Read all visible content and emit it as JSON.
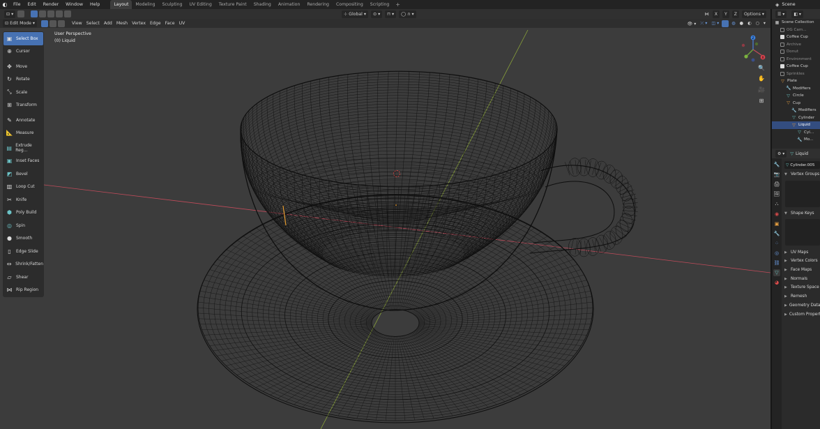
{
  "topbar": {
    "menus": [
      "File",
      "Edit",
      "Render",
      "Window",
      "Help"
    ],
    "workspaces": [
      "Layout",
      "Modeling",
      "Sculpting",
      "UV Editing",
      "Texture Paint",
      "Shading",
      "Animation",
      "Rendering",
      "Compositing",
      "Scripting"
    ],
    "active_workspace": "Layout",
    "add_tab": "+",
    "scene": "Scene"
  },
  "viewport": {
    "mode": "Edit Mode",
    "header_menus": [
      "View",
      "Select",
      "Add",
      "Mesh",
      "Vertex",
      "Edge",
      "Face",
      "UV"
    ],
    "orientation": "Global",
    "axes": [
      "X",
      "Y",
      "Z"
    ],
    "options": "Options",
    "overlay_line1": "User Perspective",
    "overlay_line2": "(0) Liquid",
    "gizmo": {
      "x": "X",
      "y": "Y",
      "z": "Z"
    }
  },
  "toolbar": {
    "tools": [
      {
        "label": "Select Box",
        "icon": "▣",
        "active": true
      },
      {
        "label": "Cursor",
        "icon": "⊕"
      },
      {
        "sep": true
      },
      {
        "label": "Move",
        "icon": "✥"
      },
      {
        "label": "Rotate",
        "icon": "↻"
      },
      {
        "label": "Scale",
        "icon": "⤡"
      },
      {
        "label": "Transform",
        "icon": "⊞"
      },
      {
        "sep": true
      },
      {
        "label": "Annotate",
        "icon": "✎"
      },
      {
        "label": "Measure",
        "icon": "📐"
      },
      {
        "sep": true
      },
      {
        "label": "Extrude Reg...",
        "icon": "▤",
        "teal": true
      },
      {
        "label": "Inset Faces",
        "icon": "▣",
        "teal": true
      },
      {
        "label": "Bevel",
        "icon": "◩",
        "teal": true
      },
      {
        "label": "Loop Cut",
        "icon": "▥"
      },
      {
        "label": "Knife",
        "icon": "✂"
      },
      {
        "label": "Poly Build",
        "icon": "⬢",
        "teal": true
      },
      {
        "label": "Spin",
        "icon": "◎",
        "teal": true
      },
      {
        "label": "Smooth",
        "icon": "●"
      },
      {
        "label": "Edge Slide",
        "icon": "▯"
      },
      {
        "label": "Shrink/Fatten",
        "icon": "⇔"
      },
      {
        "label": "Shear",
        "icon": "▱"
      },
      {
        "label": "Rip Region",
        "icon": "⋈"
      }
    ]
  },
  "outliner": {
    "title": "Scene Collection",
    "rows": [
      {
        "label": "Scene Collection",
        "indent": 0,
        "icon": "▦"
      },
      {
        "label": "OG Cam...",
        "indent": 1,
        "dim": true,
        "chk": false
      },
      {
        "label": "Coffee Cup",
        "indent": 1,
        "chk": true
      },
      {
        "label": "Archive",
        "indent": 1,
        "dim": true,
        "chk": false
      },
      {
        "label": "Donut",
        "indent": 1,
        "dim": true,
        "chk": false
      },
      {
        "label": "Environment",
        "indent": 1,
        "dim": true,
        "chk": false
      },
      {
        "label": "Coffee Cup",
        "indent": 1,
        "chk": true
      },
      {
        "label": "Sprinkles",
        "indent": 1,
        "dim": true,
        "chk": false
      },
      {
        "label": "Plate",
        "indent": 1,
        "icon": "▽",
        "color": "#e8a040"
      },
      {
        "label": "Modifiers",
        "indent": 2,
        "icon": "🔧"
      },
      {
        "label": "Circle",
        "indent": 2,
        "icon": "▽",
        "color": "#6bc6c2"
      },
      {
        "label": "Cup",
        "indent": 2,
        "icon": "▽",
        "color": "#e8a040"
      },
      {
        "label": "Modifiers",
        "indent": 3,
        "icon": "🔧"
      },
      {
        "label": "Cylinder",
        "indent": 3,
        "icon": "▽",
        "color": "#6bc6c2"
      },
      {
        "label": "Liquid",
        "indent": 3,
        "icon": "▽",
        "color": "#e8a040",
        "selected": true
      },
      {
        "label": "Cyl...",
        "indent": 4,
        "icon": "▽",
        "color": "#6bc6c2"
      },
      {
        "label": "Mo...",
        "indent": 4,
        "icon": "🔧"
      }
    ]
  },
  "properties": {
    "object_name": "Liquid",
    "mesh_name": "Cylinder.005",
    "sections_top": [
      "Vertex Groups",
      "Shape Keys"
    ],
    "sections": [
      "UV Maps",
      "Vertex Colors",
      "Face Maps",
      "Normals",
      "Texture Space",
      "Remesh",
      "Geometry Data",
      "Custom Properties"
    ]
  },
  "colors": {
    "accent": "#4772b3",
    "viewport_bg": "#3c3c3c",
    "x_axis": "#c04b5a",
    "y_axis": "#8aa33a"
  }
}
